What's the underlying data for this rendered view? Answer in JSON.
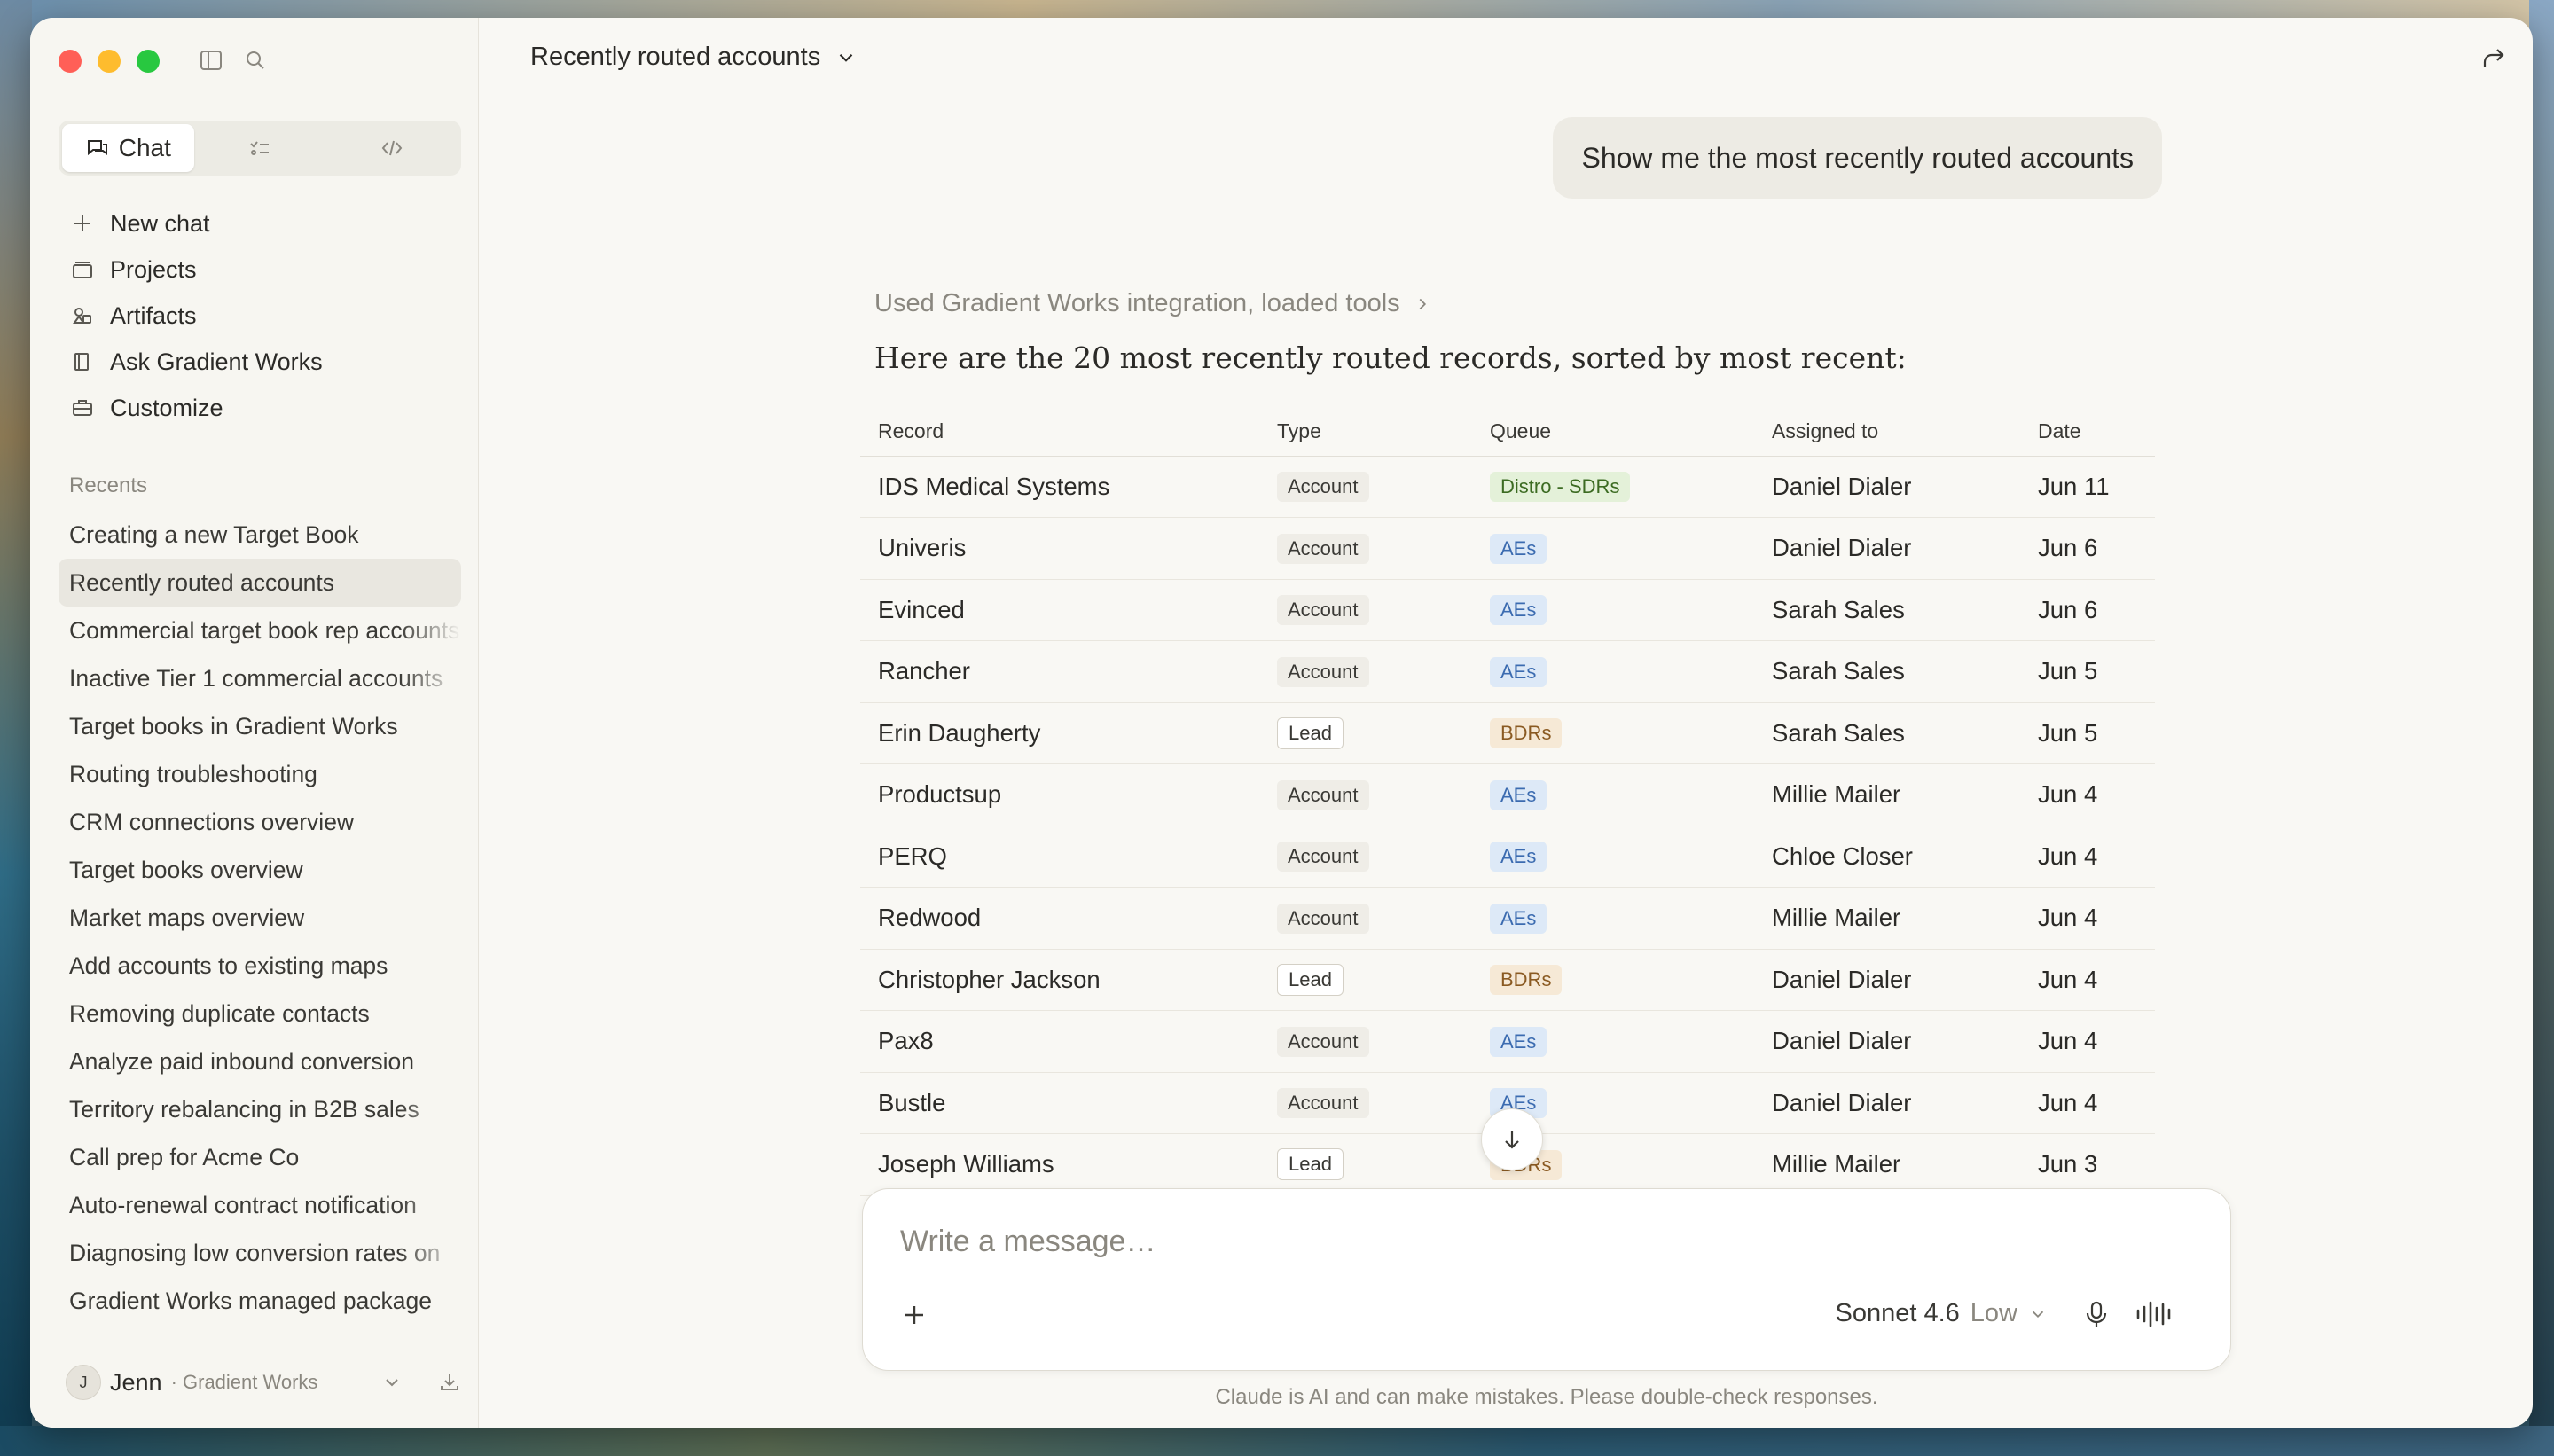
{
  "window": {
    "title": "Recently routed accounts"
  },
  "sidebar": {
    "mode_tabs": [
      {
        "label": "Chat",
        "icon": "chat-bubbles-icon",
        "active": true
      },
      {
        "label": "",
        "icon": "tasks-icon",
        "active": false
      },
      {
        "label": "",
        "icon": "code-icon",
        "active": false
      }
    ],
    "nav": [
      {
        "label": "New chat",
        "icon": "plus-icon"
      },
      {
        "label": "Projects",
        "icon": "folder-icon"
      },
      {
        "label": "Artifacts",
        "icon": "artifacts-icon"
      },
      {
        "label": "Ask Gradient Works",
        "icon": "book-icon"
      },
      {
        "label": "Customize",
        "icon": "briefcase-icon"
      }
    ],
    "recents_label": "Recents",
    "recents": [
      "Creating a new Target Book",
      "Recently routed accounts",
      "Commercial target book rep accounts",
      "Inactive Tier 1 commercial accounts",
      "Target books in Gradient Works",
      "Routing troubleshooting",
      "CRM connections overview",
      "Target books overview",
      "Market maps overview",
      "Add accounts to existing maps",
      "Removing duplicate contacts",
      "Analyze paid inbound conversion",
      "Territory rebalancing in B2B sales",
      "Call prep for Acme Co",
      "Auto-renewal contract notification",
      "Diagnosing low conversion rates on",
      "Gradient Works managed package"
    ],
    "active_recent_index": 1,
    "user": {
      "initial": "J",
      "name": "Jenn",
      "org": "· Gradient Works"
    }
  },
  "chat": {
    "title": "Recently routed accounts",
    "user_message": "Show me the most recently routed accounts",
    "tool_line": "Used Gradient Works integration, loaded tools",
    "lead": "Here are the 20 most recently routed records, sorted by most recent:",
    "table": {
      "headers": [
        "Record",
        "Type",
        "Queue",
        "Assigned to",
        "Date"
      ],
      "rows": [
        [
          "IDS Medical Systems",
          "Account",
          "Distro - SDRs",
          "Daniel Dialer",
          "Jun 11"
        ],
        [
          "Univeris",
          "Account",
          "AEs",
          "Daniel Dialer",
          "Jun 6"
        ],
        [
          "Evinced",
          "Account",
          "AEs",
          "Sarah Sales",
          "Jun 6"
        ],
        [
          "Rancher",
          "Account",
          "AEs",
          "Sarah Sales",
          "Jun 5"
        ],
        [
          "Erin Daugherty",
          "Lead",
          "BDRs",
          "Sarah Sales",
          "Jun 5"
        ],
        [
          "Productsup",
          "Account",
          "AEs",
          "Millie Mailer",
          "Jun 4"
        ],
        [
          "PERQ",
          "Account",
          "AEs",
          "Chloe Closer",
          "Jun 4"
        ],
        [
          "Redwood",
          "Account",
          "AEs",
          "Millie Mailer",
          "Jun 4"
        ],
        [
          "Christopher Jackson",
          "Lead",
          "BDRs",
          "Daniel Dialer",
          "Jun 4"
        ],
        [
          "Pax8",
          "Account",
          "AEs",
          "Daniel Dialer",
          "Jun 4"
        ],
        [
          "Bustle",
          "Account",
          "AEs",
          "Daniel Dialer",
          "Jun 4"
        ],
        [
          "Joseph Williams",
          "Lead",
          "BDRs",
          "Millie Mailer",
          "Jun 3"
        ]
      ]
    }
  },
  "composer": {
    "placeholder": "Write a message…",
    "model": "Sonnet 4.6",
    "effort": "Low",
    "disclaimer": "Claude is AI and can make mistakes. Please double-check responses."
  },
  "colors": {
    "queue_green_bg": "#e4f1d9",
    "queue_blue_bg": "#dde9f7",
    "queue_amber_bg": "#f6e9d6",
    "active_recent_bg": "#e9e7e0"
  }
}
